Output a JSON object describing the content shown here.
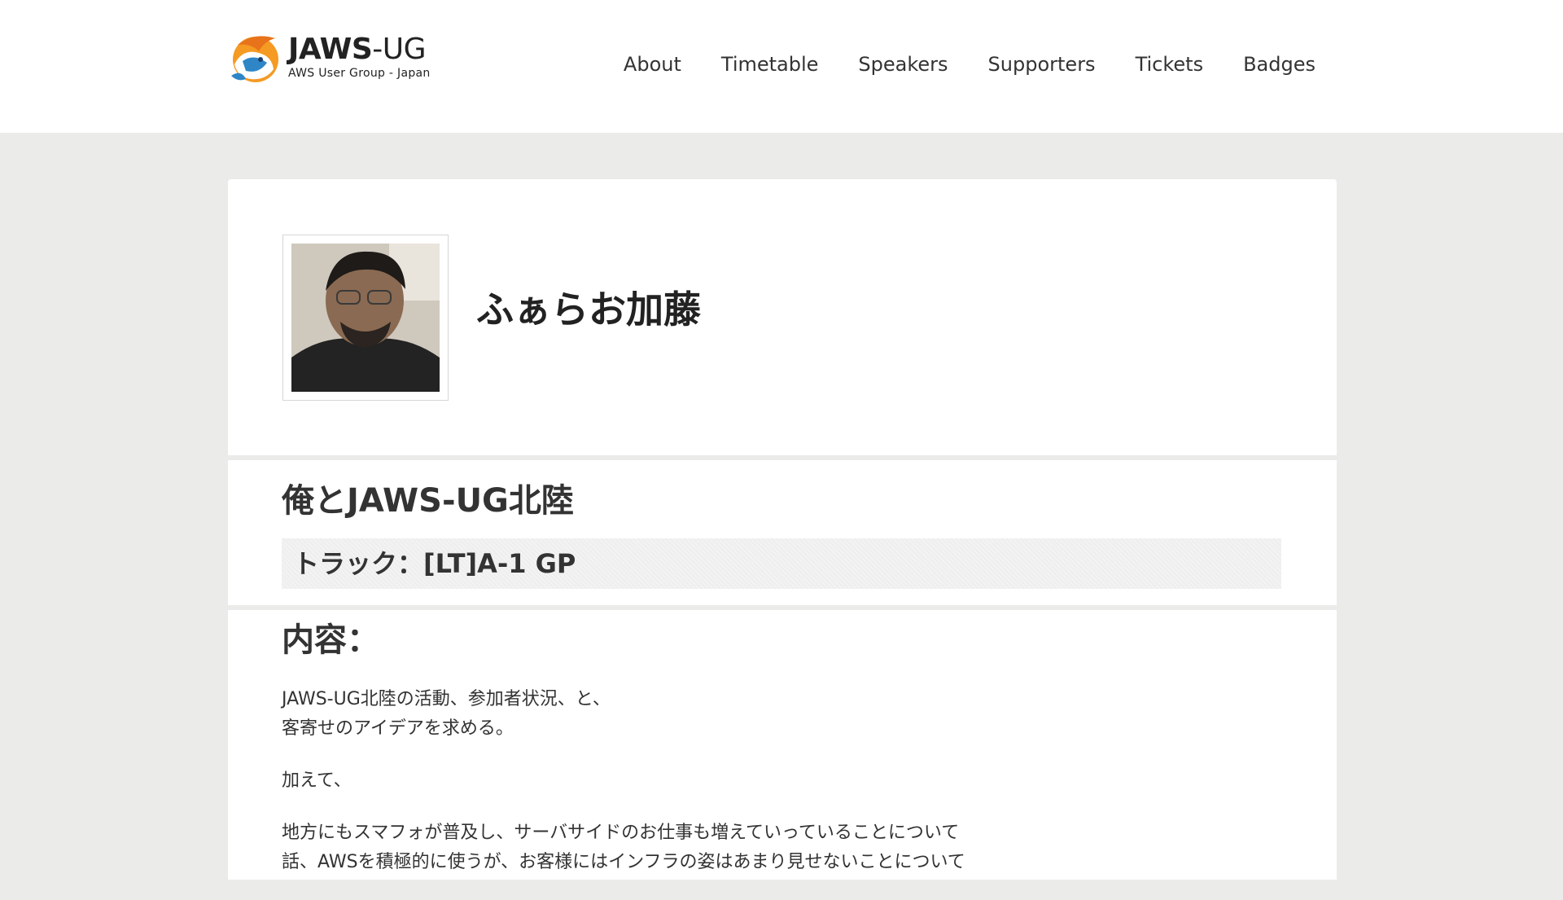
{
  "header": {
    "logo_title_bold": "JAWS",
    "logo_title_rest": "-UG",
    "logo_subtitle": "AWS User Group - Japan",
    "nav": [
      {
        "label": "About"
      },
      {
        "label": "Timetable"
      },
      {
        "label": "Speakers"
      },
      {
        "label": "Supporters"
      },
      {
        "label": "Tickets"
      },
      {
        "label": "Badges"
      }
    ]
  },
  "speaker": {
    "name": "ふぁらお加藤"
  },
  "talk": {
    "title": "俺とJAWS-UG北陸",
    "track": "トラック：[LT]A-1 GP"
  },
  "content": {
    "heading": "内容：",
    "paragraphs": [
      [
        "JAWS-UG北陸の活動、参加者状況、と、",
        "客寄せのアイデアを求める。"
      ],
      [
        "加えて、"
      ],
      [
        "地方にもスマフォが普及し、サーバサイドのお仕事も増えていっていることについて",
        "話、AWSを積極的に使うが、お客様にはインフラの姿はあまり見せないことについて"
      ]
    ]
  },
  "colors": {
    "background": "#ebebea",
    "card": "#ffffff",
    "logo_orange": "#f59a23",
    "logo_blue": "#2f86c6"
  }
}
